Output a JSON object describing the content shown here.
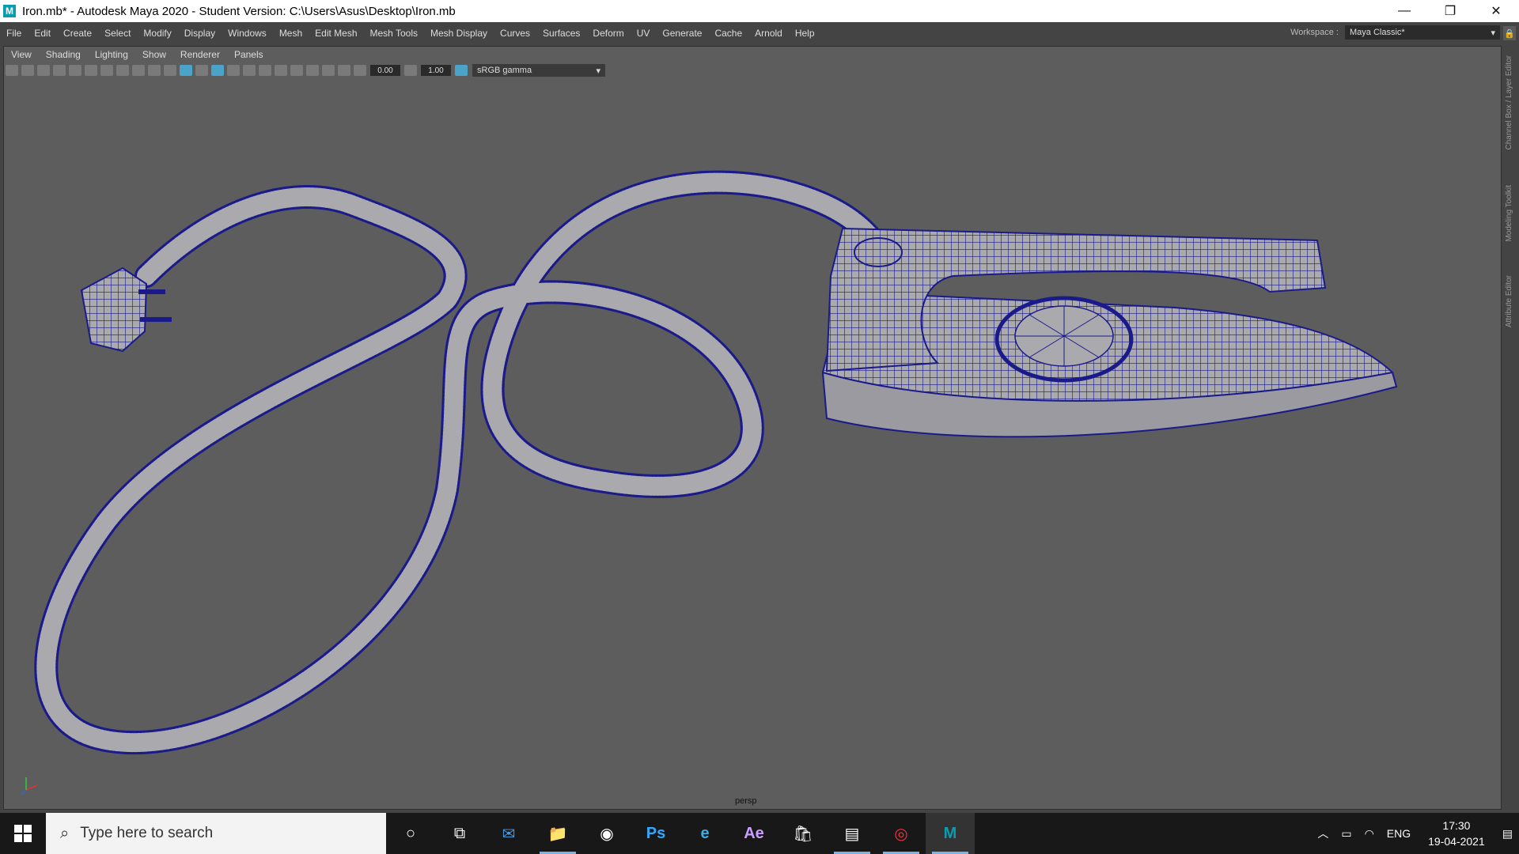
{
  "window": {
    "app_icon": "M",
    "title": "Iron.mb* - Autodesk Maya 2020 - Student Version: C:\\Users\\Asus\\Desktop\\Iron.mb",
    "minimize": "—",
    "maximize": "❐",
    "close": "✕"
  },
  "menubar": [
    "File",
    "Edit",
    "Create",
    "Select",
    "Modify",
    "Display",
    "Windows",
    "Mesh",
    "Edit Mesh",
    "Mesh Tools",
    "Mesh Display",
    "Curves",
    "Surfaces",
    "Deform",
    "UV",
    "Generate",
    "Cache",
    "Arnold",
    "Help"
  ],
  "workspace": {
    "label": "Workspace :",
    "value": "Maya Classic*"
  },
  "panel_menu": [
    "View",
    "Shading",
    "Lighting",
    "Show",
    "Renderer",
    "Panels"
  ],
  "panel_toolbar": {
    "field1": "0.00",
    "field2": "1.00",
    "color_space": "sRGB gamma"
  },
  "viewport": {
    "camera_label": "persp",
    "wire_color": "#1a1a8a",
    "mesh_color": "#a9a9ae",
    "bg_color": "#5d5d5d"
  },
  "side_tabs": [
    "Channel Box / Layer Editor",
    "Modeling Toolkit",
    "Attribute Editor"
  ],
  "taskbar": {
    "search_placeholder": "Type here to search",
    "apps": [
      "cortana-icon",
      "task-view-icon",
      "mail-icon",
      "file-explorer-icon",
      "media-icon",
      "photoshop-icon",
      "edge-icon",
      "after-effects-icon",
      "store-icon",
      "mail-app-icon",
      "chrome-icon",
      "maya-icon"
    ],
    "app_glyphs": [
      "○",
      "⧉",
      "✉",
      "📁",
      "◉",
      "Ps",
      "e",
      "Ae",
      "🛍",
      "▤",
      "◎",
      "M"
    ],
    "tray_language": "ENG",
    "time": "17:30",
    "date": "19-04-2021"
  }
}
